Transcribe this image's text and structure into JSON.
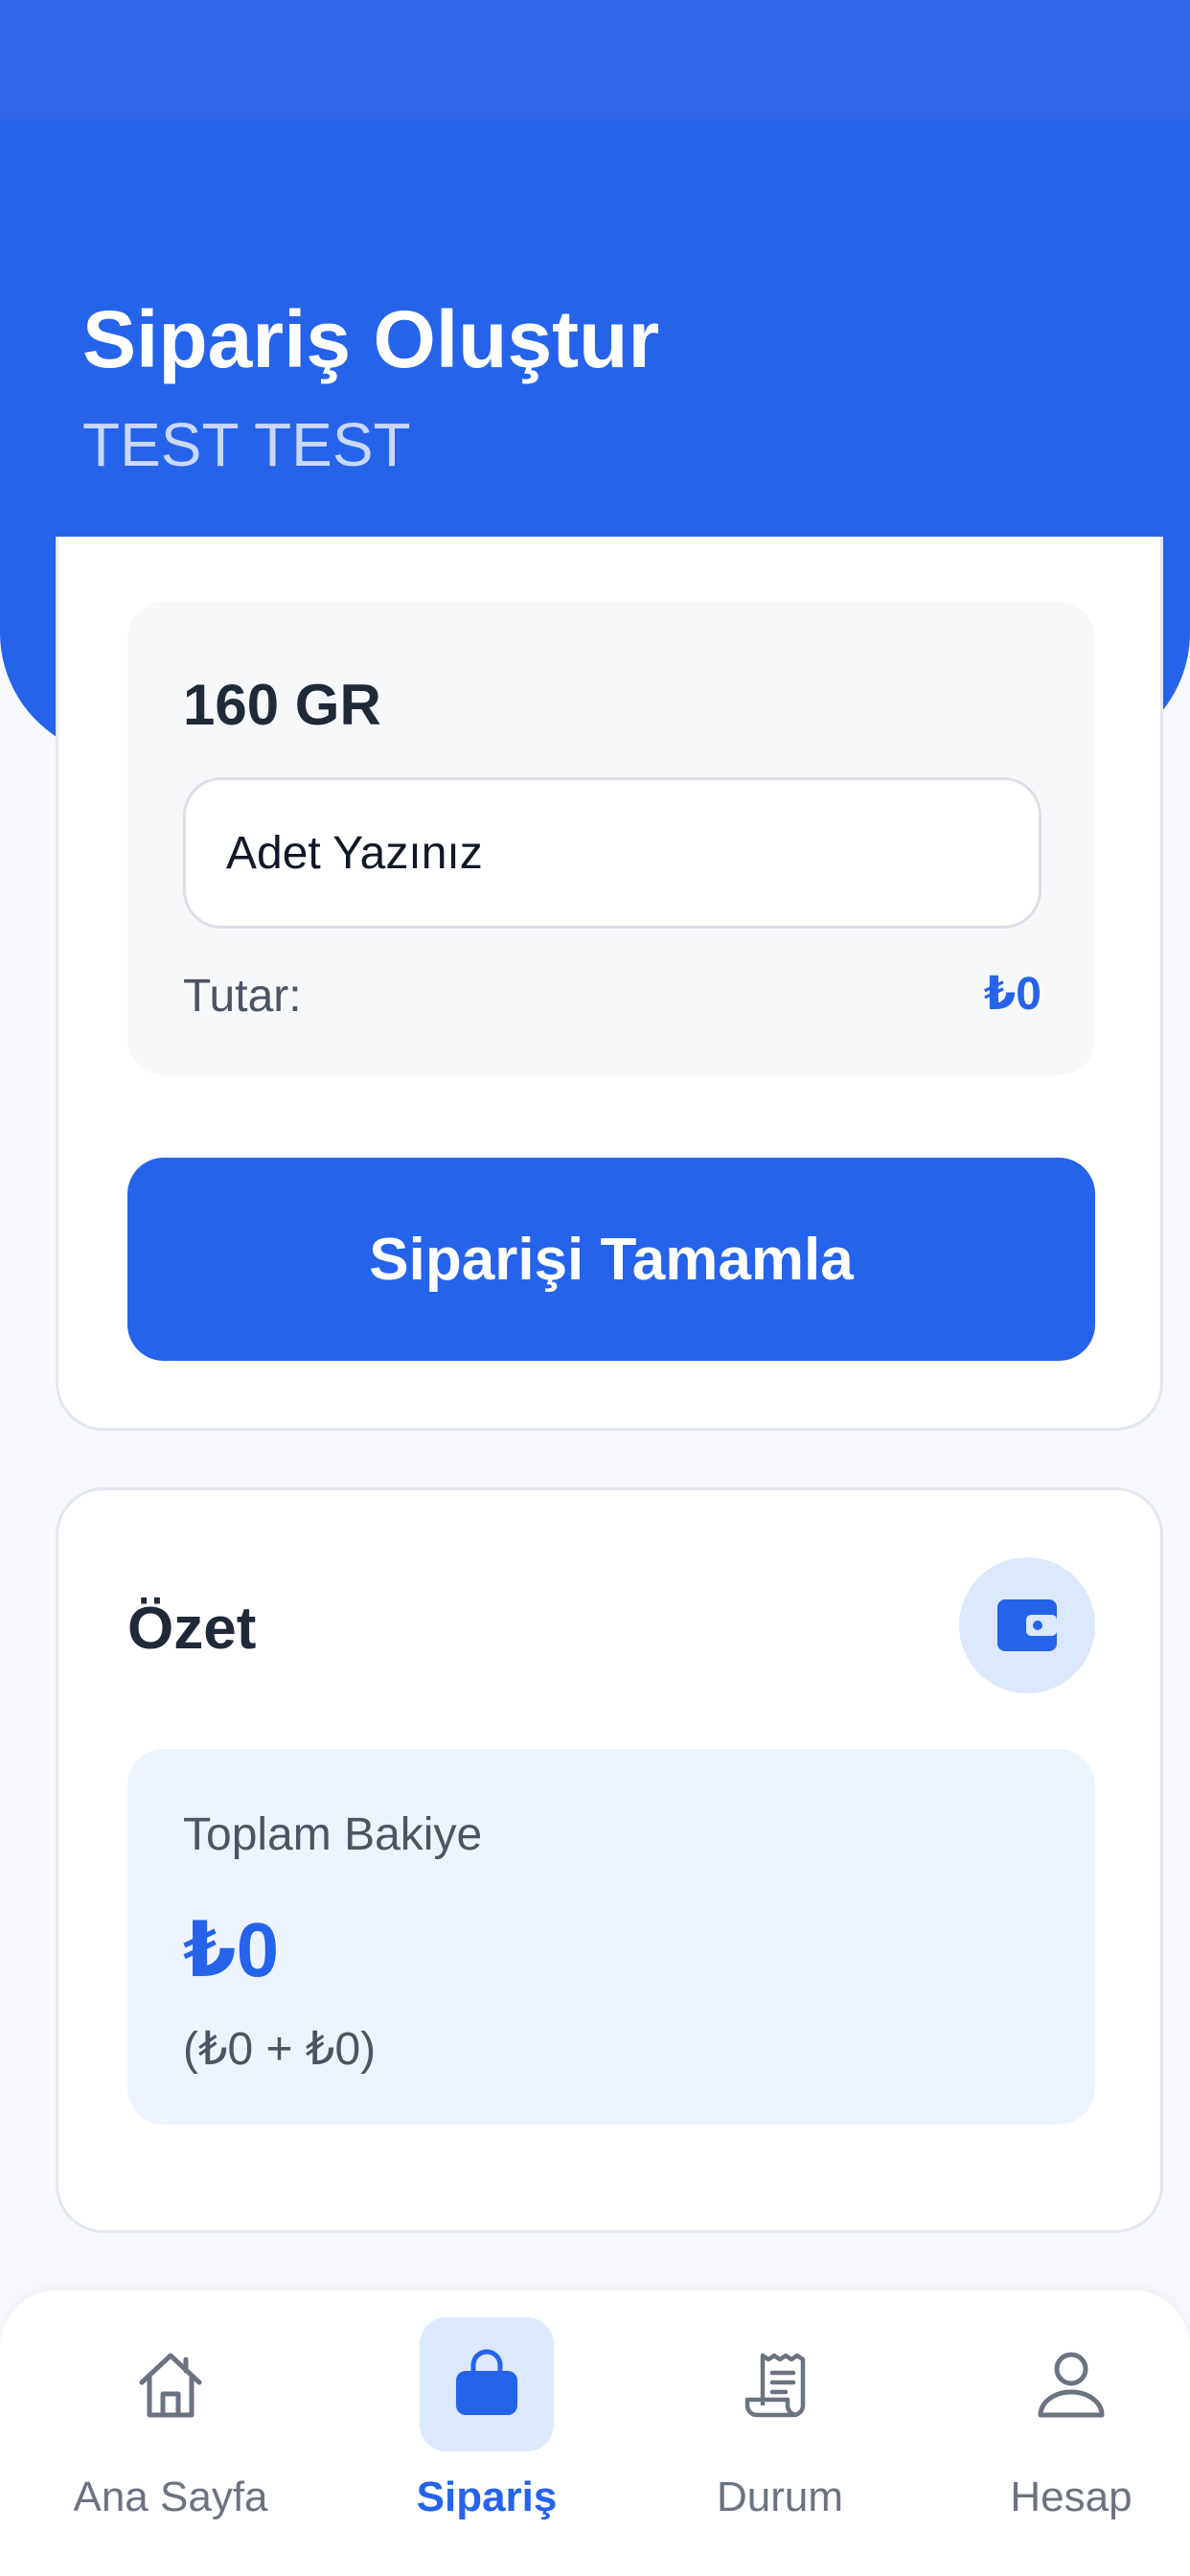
{
  "header": {
    "title": "Sipariş Oluştur",
    "subtitle": "TEST TEST"
  },
  "order": {
    "product_name": "160 GR",
    "quantity_value": "",
    "quantity_placeholder": "Adet Yazınız",
    "amount_label": "Tutar:",
    "amount_value": "₺0",
    "complete_button": "Siparişi Tamamla"
  },
  "summary": {
    "title": "Özet",
    "icon": "wallet-icon",
    "balance_label": "Toplam Bakiye",
    "balance_value": "₺0",
    "balance_breakdown": "(₺0 + ₺0)"
  },
  "bottom_nav": {
    "items": [
      {
        "label": "Ana Sayfa",
        "icon": "home-icon",
        "active": false
      },
      {
        "label": "Sipariş",
        "icon": "shopping-bag-icon",
        "active": true
      },
      {
        "label": "Durum",
        "icon": "receipt-icon",
        "active": false
      },
      {
        "label": "Hesap",
        "icon": "user-icon",
        "active": false
      }
    ]
  },
  "colors": {
    "primary": "#2563eb",
    "background": "#f7f9fc",
    "card": "#ffffff",
    "muted_text": "#6b7280",
    "accent_light": "#dbe8fd"
  }
}
